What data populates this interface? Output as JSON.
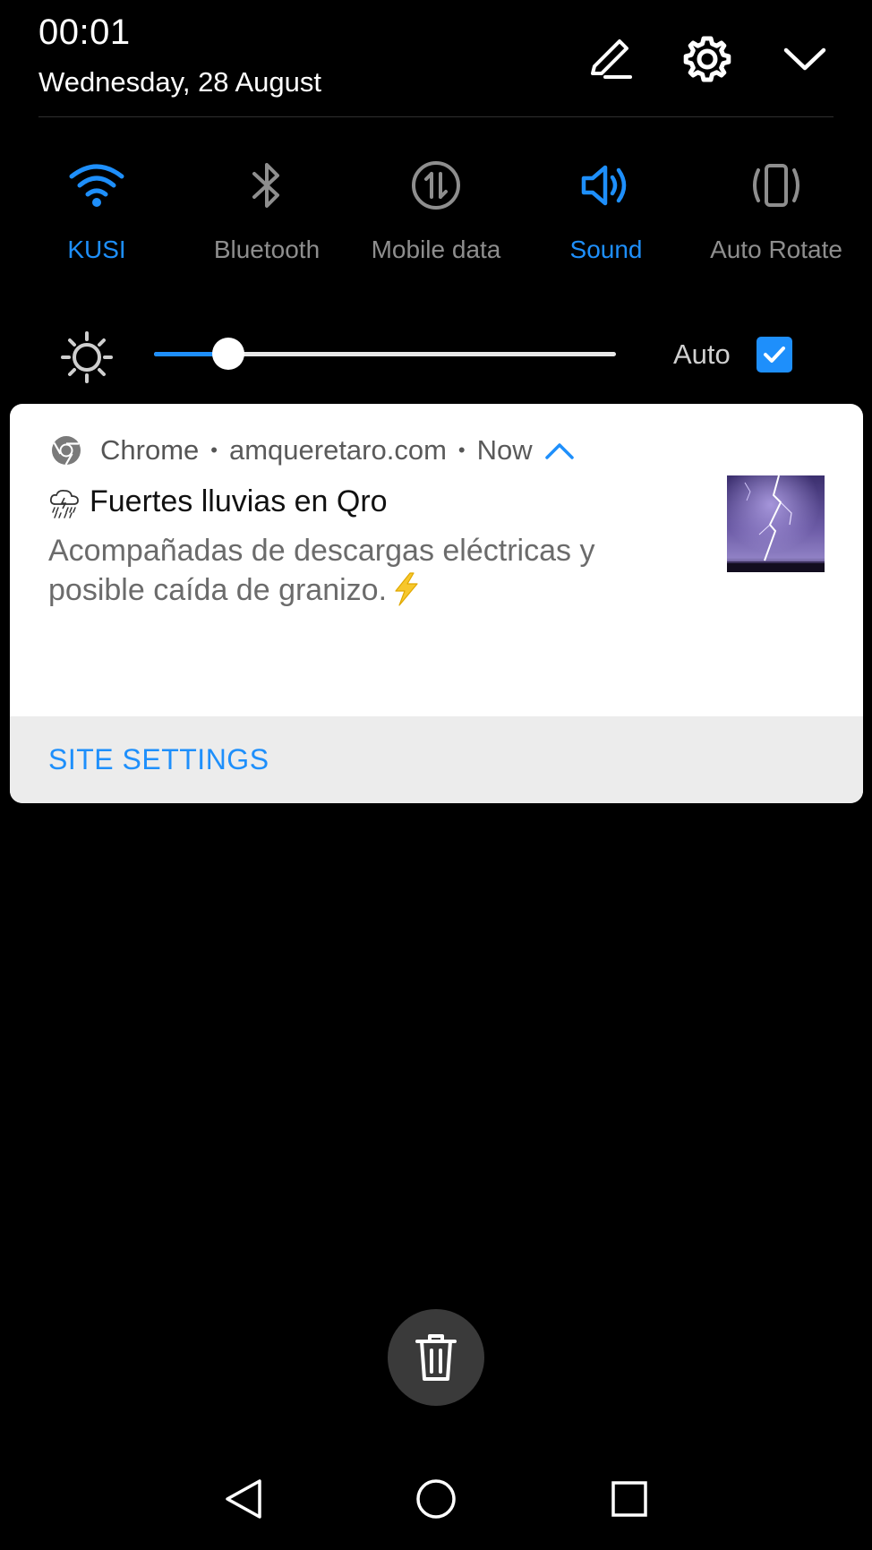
{
  "status": {
    "time": "00:01",
    "date": "Wednesday, 28 August"
  },
  "header_icons": [
    "edit-icon",
    "settings-icon",
    "collapse-icon"
  ],
  "toggles": [
    {
      "label": "KUSI",
      "icon": "wifi-icon",
      "active": true
    },
    {
      "label": "Bluetooth",
      "icon": "bluetooth-icon",
      "active": false
    },
    {
      "label": "Mobile data",
      "icon": "mobile-data-icon",
      "active": false
    },
    {
      "label": "Sound",
      "icon": "sound-icon",
      "active": true
    },
    {
      "label": "Auto Rotate",
      "icon": "auto-rotate-icon",
      "active": false
    }
  ],
  "brightness": {
    "level": 0.16,
    "auto_label": "Auto",
    "auto_checked": true
  },
  "notification": {
    "app": "Chrome",
    "site": "amqueretaro.com",
    "time": "Now",
    "separator": "•",
    "title": "Fuertes lluvias en Qro",
    "body": "Acompañadas de descargas eléctricas y posible caída de granizo.",
    "action": "SITE SETTINGS",
    "thumbnail": "lightning-storm-photo"
  },
  "colors": {
    "accent": "#1e8ffb",
    "background": "#000000",
    "card": "#ffffff",
    "inactive": "#8e8e8e"
  },
  "nav": [
    "back-icon",
    "home-icon",
    "recents-icon"
  ]
}
